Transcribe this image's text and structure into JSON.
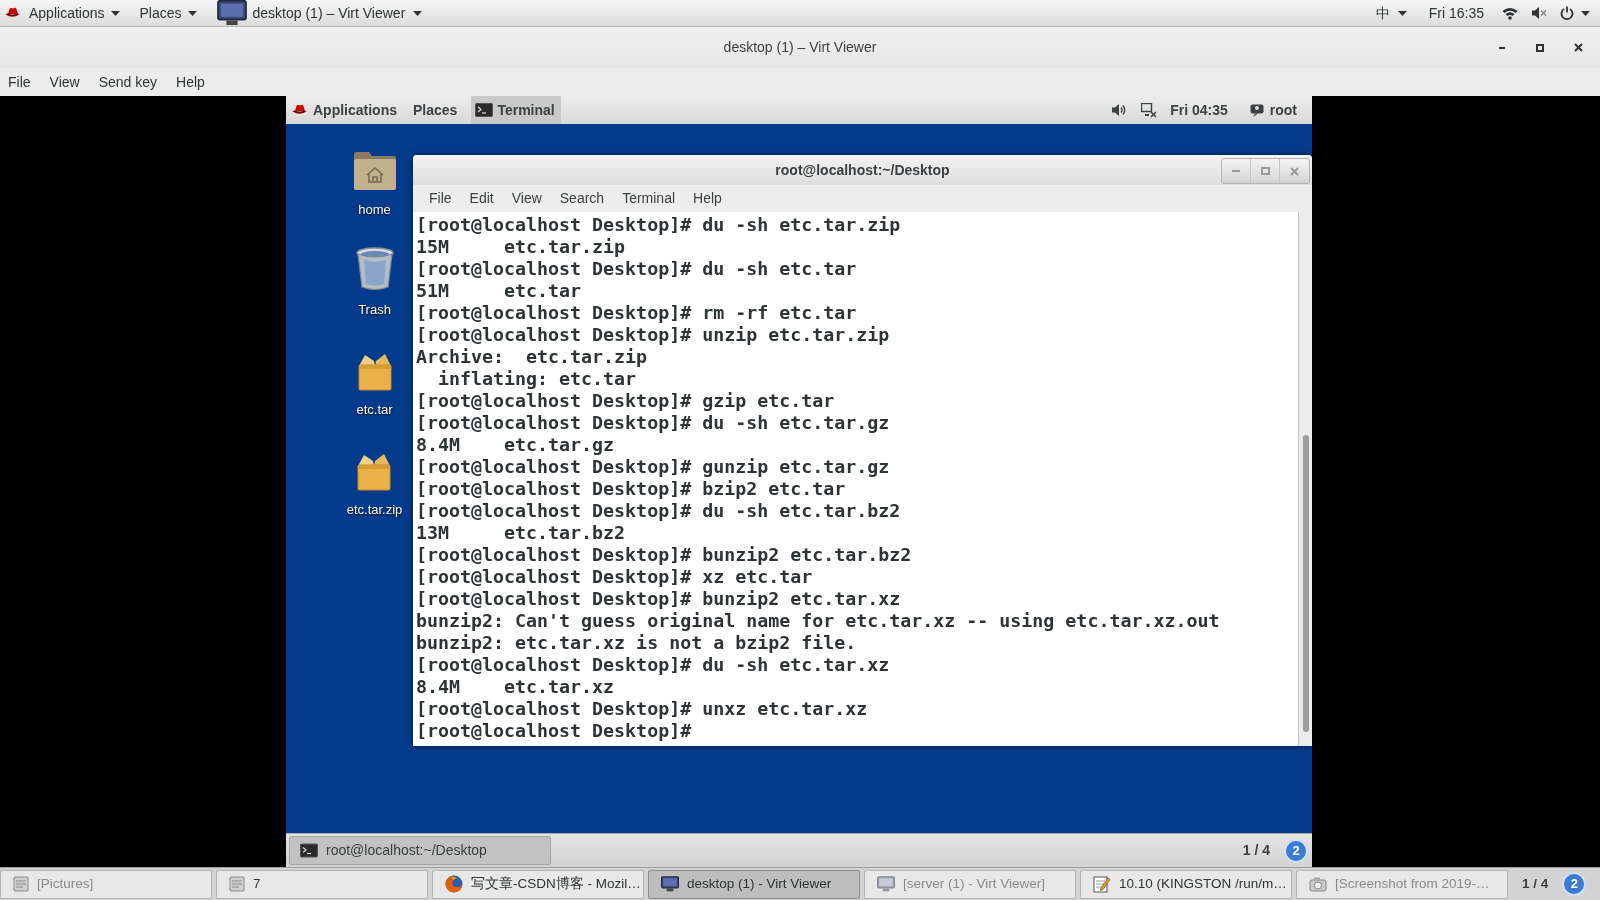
{
  "host_top_bar": {
    "applications": "Applications",
    "places": "Places",
    "active_window": "desktop (1) – Virt Viewer",
    "input_method": "中",
    "clock": "Fri 16:35"
  },
  "window": {
    "title": "desktop (1) – Virt Viewer",
    "menu": [
      "File",
      "View",
      "Send key",
      "Help"
    ]
  },
  "guest": {
    "top_panel": {
      "applications": "Applications",
      "places": "Places",
      "task": "Terminal",
      "clock": "Fri 04:35",
      "user": "root"
    },
    "desktop_icons": [
      {
        "kind": "home",
        "label": "home"
      },
      {
        "kind": "trash",
        "label": "Trash"
      },
      {
        "kind": "archive",
        "label": "etc.tar"
      },
      {
        "kind": "archive",
        "label": "etc.tar.zip"
      }
    ],
    "terminal": {
      "title": "root@localhost:~/Desktop",
      "menu": [
        "File",
        "Edit",
        "View",
        "Search",
        "Terminal",
        "Help"
      ],
      "lines": [
        "[root@localhost Desktop]# du -sh etc.tar.zip",
        "15M     etc.tar.zip",
        "[root@localhost Desktop]# du -sh etc.tar",
        "51M     etc.tar",
        "[root@localhost Desktop]# rm -rf etc.tar",
        "[root@localhost Desktop]# unzip etc.tar.zip",
        "Archive:  etc.tar.zip",
        "  inflating: etc.tar",
        "[root@localhost Desktop]# gzip etc.tar",
        "[root@localhost Desktop]# du -sh etc.tar.gz",
        "8.4M    etc.tar.gz",
        "[root@localhost Desktop]# gunzip etc.tar.gz",
        "[root@localhost Desktop]# bzip2 etc.tar",
        "[root@localhost Desktop]# du -sh etc.tar.bz2",
        "13M     etc.tar.bz2",
        "[root@localhost Desktop]# bunzip2 etc.tar.bz2",
        "[root@localhost Desktop]# xz etc.tar",
        "[root@localhost Desktop]# bunzip2 etc.tar.xz",
        "bunzip2: Can't guess original name for etc.tar.xz -- using etc.tar.xz.out",
        "bunzip2: etc.tar.xz is not a bzip2 file.",
        "[root@localhost Desktop]# du -sh etc.tar.xz",
        "8.4M    etc.tar.xz",
        "[root@localhost Desktop]# unxz etc.tar.xz",
        "[root@localhost Desktop]#"
      ]
    },
    "bottom_panel": {
      "task": "root@localhost:~/Desktop",
      "workspace": "1 / 4",
      "notifications": "2"
    }
  },
  "taskbar": {
    "items": [
      {
        "kind": "generic",
        "label": "[Pictures]",
        "minimized": true,
        "selected": false
      },
      {
        "kind": "generic",
        "label": "7",
        "minimized": false,
        "selected": false
      },
      {
        "kind": "browser",
        "label": "写文章-CSDN博客 - Mozil…",
        "minimized": false,
        "selected": false
      },
      {
        "kind": "viewer",
        "label": "desktop (1) - Virt Viewer",
        "minimized": false,
        "selected": true
      },
      {
        "kind": "viewer",
        "label": "[server (1) - Virt Viewer]",
        "minimized": true,
        "selected": false
      },
      {
        "kind": "editor",
        "label": "10.10 (KINGSTON /run/m…",
        "minimized": false,
        "selected": false
      },
      {
        "kind": "screenshot",
        "label": "[Screenshot from 2019-…",
        "minimized": true,
        "selected": false
      }
    ],
    "workspace": "1 / 4",
    "notifications": "2"
  }
}
